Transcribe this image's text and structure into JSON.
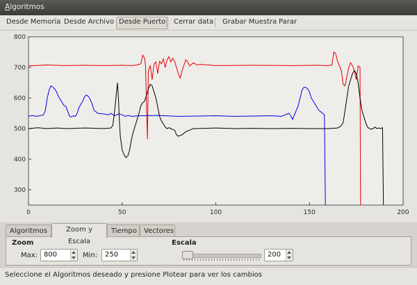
{
  "window": {
    "title": "Algoritmos"
  },
  "menubar": {
    "items": [
      {
        "label": "Desde Memoria"
      },
      {
        "label": "Desde Archivo"
      },
      {
        "label": "Desde Puerto",
        "pressed": true
      },
      {
        "label": "Cerrar data"
      },
      {
        "label": "Grabar Muestra"
      },
      {
        "label": "Parar"
      }
    ]
  },
  "chart_data": {
    "type": "line",
    "xlim": [
      0,
      200
    ],
    "ylim": [
      250,
      800
    ],
    "x_ticks": [
      0,
      50,
      100,
      150,
      200
    ],
    "y_ticks": [
      300,
      400,
      500,
      600,
      700,
      800
    ],
    "grid": false,
    "legend": "none",
    "series": [
      {
        "color": "#e00000",
        "points": [
          [
            0,
            705
          ],
          [
            10,
            708
          ],
          [
            20,
            706
          ],
          [
            30,
            707
          ],
          [
            40,
            706
          ],
          [
            50,
            707
          ],
          [
            55,
            706
          ],
          [
            58,
            708
          ],
          [
            60,
            712
          ],
          [
            61,
            740
          ],
          [
            62,
            730
          ],
          [
            62.5,
            706
          ],
          [
            63,
            580
          ],
          [
            63.5,
            465
          ],
          [
            64,
            690
          ],
          [
            65,
            705
          ],
          [
            66,
            660
          ],
          [
            67,
            710
          ],
          [
            68,
            718
          ],
          [
            69,
            680
          ],
          [
            70,
            720
          ],
          [
            71,
            712
          ],
          [
            72,
            728
          ],
          [
            73,
            700
          ],
          [
            74,
            725
          ],
          [
            75,
            735
          ],
          [
            76,
            718
          ],
          [
            77,
            730
          ],
          [
            78,
            720
          ],
          [
            79,
            700
          ],
          [
            80,
            680
          ],
          [
            81,
            665
          ],
          [
            82,
            690
          ],
          [
            84,
            725
          ],
          [
            85,
            718
          ],
          [
            86,
            705
          ],
          [
            88,
            715
          ],
          [
            90,
            708
          ],
          [
            92,
            710
          ],
          [
            100,
            706
          ],
          [
            120,
            707
          ],
          [
            140,
            706
          ],
          [
            155,
            707
          ],
          [
            158,
            706
          ],
          [
            160,
            706
          ],
          [
            162,
            708
          ],
          [
            163,
            750
          ],
          [
            164,
            745
          ],
          [
            165,
            720
          ],
          [
            166,
            705
          ],
          [
            167,
            690
          ],
          [
            168,
            645
          ],
          [
            169,
            640
          ],
          [
            170,
            670
          ],
          [
            171,
            700
          ],
          [
            172,
            715
          ],
          [
            173,
            705
          ],
          [
            174,
            690
          ],
          [
            175,
            660
          ],
          [
            176,
            705
          ],
          [
            177,
            700
          ],
          [
            177.3,
            250
          ]
        ]
      },
      {
        "color": "#0000e0",
        "points": [
          [
            0,
            540
          ],
          [
            2,
            543
          ],
          [
            4,
            540
          ],
          [
            6,
            542
          ],
          [
            8,
            545
          ],
          [
            9,
            560
          ],
          [
            10,
            600
          ],
          [
            11,
            625
          ],
          [
            12,
            640
          ],
          [
            13,
            635
          ],
          [
            14,
            630
          ],
          [
            15,
            620
          ],
          [
            16,
            605
          ],
          [
            17,
            595
          ],
          [
            18,
            585
          ],
          [
            19,
            575
          ],
          [
            20,
            572
          ],
          [
            21,
            555
          ],
          [
            22,
            540
          ],
          [
            23,
            538
          ],
          [
            24,
            542
          ],
          [
            25,
            540
          ],
          [
            26,
            550
          ],
          [
            27,
            570
          ],
          [
            28,
            580
          ],
          [
            29,
            590
          ],
          [
            30,
            605
          ],
          [
            31,
            610
          ],
          [
            32,
            605
          ],
          [
            33,
            595
          ],
          [
            34,
            580
          ],
          [
            35,
            560
          ],
          [
            36,
            555
          ],
          [
            37,
            550
          ],
          [
            40,
            548
          ],
          [
            43,
            545
          ],
          [
            44,
            550
          ],
          [
            46,
            542
          ],
          [
            48,
            548
          ],
          [
            50,
            545
          ],
          [
            52,
            540
          ],
          [
            53,
            543
          ],
          [
            55,
            540
          ],
          [
            60,
            542
          ],
          [
            70,
            543
          ],
          [
            80,
            540
          ],
          [
            90,
            541
          ],
          [
            100,
            542
          ],
          [
            110,
            540
          ],
          [
            120,
            541
          ],
          [
            130,
            542
          ],
          [
            135,
            540
          ],
          [
            137,
            545
          ],
          [
            139,
            550
          ],
          [
            140,
            542
          ],
          [
            141,
            530
          ],
          [
            142,
            545
          ],
          [
            143,
            560
          ],
          [
            144,
            575
          ],
          [
            145,
            600
          ],
          [
            146,
            625
          ],
          [
            147,
            635
          ],
          [
            148,
            635
          ],
          [
            149,
            630
          ],
          [
            150,
            620
          ],
          [
            151,
            600
          ],
          [
            152,
            590
          ],
          [
            153,
            580
          ],
          [
            154,
            570
          ],
          [
            155,
            560
          ],
          [
            156,
            555
          ],
          [
            157,
            550
          ],
          [
            158,
            545
          ],
          [
            158.5,
            250
          ]
        ]
      },
      {
        "color": "#000000",
        "points": [
          [
            0,
            500
          ],
          [
            5,
            503
          ],
          [
            10,
            500
          ],
          [
            15,
            502
          ],
          [
            20,
            500
          ],
          [
            30,
            502
          ],
          [
            40,
            500
          ],
          [
            44,
            502
          ],
          [
            45,
            510
          ],
          [
            46,
            560
          ],
          [
            47,
            620
          ],
          [
            47.5,
            650
          ],
          [
            48,
            600
          ],
          [
            48.5,
            530
          ],
          [
            49,
            475
          ],
          [
            50,
            430
          ],
          [
            51,
            415
          ],
          [
            52,
            405
          ],
          [
            53,
            410
          ],
          [
            54,
            430
          ],
          [
            55,
            465
          ],
          [
            56,
            490
          ],
          [
            57,
            510
          ],
          [
            58,
            530
          ],
          [
            59,
            550
          ],
          [
            60,
            575
          ],
          [
            61,
            585
          ],
          [
            62,
            590
          ],
          [
            63,
            610
          ],
          [
            64,
            630
          ],
          [
            65,
            645
          ],
          [
            66,
            640
          ],
          [
            67,
            620
          ],
          [
            68,
            600
          ],
          [
            69,
            570
          ],
          [
            70,
            540
          ],
          [
            71,
            525
          ],
          [
            72,
            515
          ],
          [
            73,
            505
          ],
          [
            74,
            500
          ],
          [
            75,
            503
          ],
          [
            76,
            500
          ],
          [
            78,
            495
          ],
          [
            79,
            480
          ],
          [
            80,
            475
          ],
          [
            82,
            480
          ],
          [
            84,
            490
          ],
          [
            86,
            495
          ],
          [
            88,
            500
          ],
          [
            90,
            500
          ],
          [
            100,
            502
          ],
          [
            110,
            500
          ],
          [
            120,
            501
          ],
          [
            130,
            500
          ],
          [
            140,
            501
          ],
          [
            150,
            500
          ],
          [
            160,
            500
          ],
          [
            165,
            502
          ],
          [
            166,
            505
          ],
          [
            167,
            510
          ],
          [
            168,
            520
          ],
          [
            169,
            560
          ],
          [
            170,
            600
          ],
          [
            171,
            640
          ],
          [
            172,
            660
          ],
          [
            173,
            680
          ],
          [
            174,
            690
          ],
          [
            175,
            680
          ],
          [
            176,
            650
          ],
          [
            177,
            600
          ],
          [
            178,
            560
          ],
          [
            179,
            540
          ],
          [
            180,
            520
          ],
          [
            181,
            505
          ],
          [
            182,
            500
          ],
          [
            183,
            498
          ],
          [
            184,
            500
          ],
          [
            185,
            505
          ],
          [
            186,
            500
          ],
          [
            187,
            502
          ],
          [
            188,
            500
          ],
          [
            189,
            503
          ],
          [
            189.5,
            250
          ]
        ]
      }
    ]
  },
  "tabs": [
    {
      "label": "Algoritmos",
      "active": false
    },
    {
      "label": "Zoom y Escala",
      "active": true
    },
    {
      "label": "Tiempo",
      "active": false
    },
    {
      "label": "Vectores",
      "active": false
    }
  ],
  "zoom": {
    "title": "Zoom",
    "max_label": "Max:",
    "max_value": "800",
    "min_label": "Min:",
    "min_value": "250"
  },
  "escala": {
    "title": "Escala",
    "value": "200",
    "slider_fraction": 0.0
  },
  "statusbar": {
    "text": "Seleccione el Algoritmos deseado y presione Plotear para ver los cambios"
  }
}
